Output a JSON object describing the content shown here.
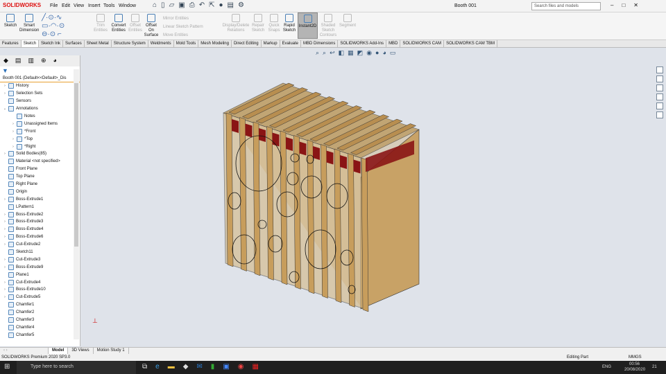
{
  "app": {
    "name": "SOLIDWORKS",
    "document_title": "Booth 001",
    "search_placeholder": "Search files and models"
  },
  "menu": [
    "File",
    "Edit",
    "View",
    "Insert",
    "Tools",
    "Window"
  ],
  "ribbon": [
    {
      "label": "Sketch",
      "enabled": true
    },
    {
      "label": "Smart Dimension",
      "enabled": true
    },
    {
      "label": "Trim Entities",
      "enabled": false
    },
    {
      "label": "Convert Entities",
      "enabled": true
    },
    {
      "label": "Offset Entities",
      "enabled": false
    },
    {
      "label": "Offset On Surface",
      "enabled": true
    },
    {
      "label": "Mirror Entities",
      "enabled": false
    },
    {
      "label": "Linear Sketch Pattern",
      "enabled": false
    },
    {
      "label": "Move Entities",
      "enabled": false
    },
    {
      "label": "Display/Delete Relations",
      "enabled": false
    },
    {
      "label": "Repair Sketch",
      "enabled": false
    },
    {
      "label": "Quick Snaps",
      "enabled": false
    },
    {
      "label": "Rapid Sketch",
      "enabled": true
    },
    {
      "label": "Instant2D",
      "enabled": true
    },
    {
      "label": "Shaded Sketch Contours",
      "enabled": false
    },
    {
      "label": "Segment",
      "enabled": false
    }
  ],
  "tabs": [
    "Features",
    "Sketch",
    "Sketch Ink",
    "Surfaces",
    "Sheet Metal",
    "Structure System",
    "Weldments",
    "Mold Tools",
    "Mesh Modeling",
    "Direct Editing",
    "Markup",
    "Evaluate",
    "MBD Dimensions",
    "SOLIDWORKS Add-Ins",
    "MBD",
    "SOLIDWORKS CAM",
    "SOLIDWORKS CAM TBM"
  ],
  "active_tab": "Sketch",
  "tree": {
    "root": "Booth 001  (Default<<Default>_Dis",
    "items": [
      {
        "label": "History",
        "arrow": "›"
      },
      {
        "label": "Selection Sets",
        "arrow": "›"
      },
      {
        "label": "Sensors",
        "arrow": ""
      },
      {
        "label": "Annotations",
        "arrow": "⌄"
      },
      {
        "label": "Notes",
        "arrow": "",
        "indent": 1
      },
      {
        "label": "Unassigned Items",
        "arrow": "›",
        "indent": 1
      },
      {
        "label": "*Front",
        "arrow": "›",
        "indent": 1
      },
      {
        "label": "*Top",
        "arrow": "›",
        "indent": 1
      },
      {
        "label": "*Right",
        "arrow": "›",
        "indent": 1
      },
      {
        "label": "Solid Bodies(85)",
        "arrow": "›"
      },
      {
        "label": "Material <not specified>",
        "arrow": ""
      },
      {
        "label": "Front Plane",
        "arrow": ""
      },
      {
        "label": "Top Plane",
        "arrow": ""
      },
      {
        "label": "Right Plane",
        "arrow": ""
      },
      {
        "label": "Origin",
        "arrow": ""
      },
      {
        "label": "Boss-Extrude1",
        "arrow": "›"
      },
      {
        "label": "LPattern1",
        "arrow": ""
      },
      {
        "label": "Boss-Extrude2",
        "arrow": "›"
      },
      {
        "label": "Boss-Extrude3",
        "arrow": "›"
      },
      {
        "label": "Boss-Extrude4",
        "arrow": "›"
      },
      {
        "label": "Boss-Extrude6",
        "arrow": "›"
      },
      {
        "label": "Cut-Extrude2",
        "arrow": "›"
      },
      {
        "label": "Sketch11",
        "arrow": ""
      },
      {
        "label": "Cut-Extrude3",
        "arrow": "›"
      },
      {
        "label": "Boss-Extrude9",
        "arrow": "›"
      },
      {
        "label": "Plane1",
        "arrow": ""
      },
      {
        "label": "Cut-Extrude4",
        "arrow": "›"
      },
      {
        "label": "Boss-Extrude10",
        "arrow": "›"
      },
      {
        "label": "Cut-Extrude5",
        "arrow": "›"
      },
      {
        "label": "Chamfer1",
        "arrow": ""
      },
      {
        "label": "Chamfer2",
        "arrow": ""
      },
      {
        "label": "Chamfer3",
        "arrow": ""
      },
      {
        "label": "Chamfer4",
        "arrow": ""
      },
      {
        "label": "Chamfer5",
        "arrow": ""
      }
    ]
  },
  "bottom_tabs": [
    "Model",
    "3D Views",
    "Motion Study 1"
  ],
  "status": {
    "version": "SOLIDWORKS Premium 2020 SP3.0",
    "mode": "Editing Part",
    "units": "MMGS"
  },
  "taskbar": {
    "search": "Type here to search",
    "lang": "ENG",
    "time": "00:56",
    "date": "20/08/2020",
    "notifications": "21"
  }
}
